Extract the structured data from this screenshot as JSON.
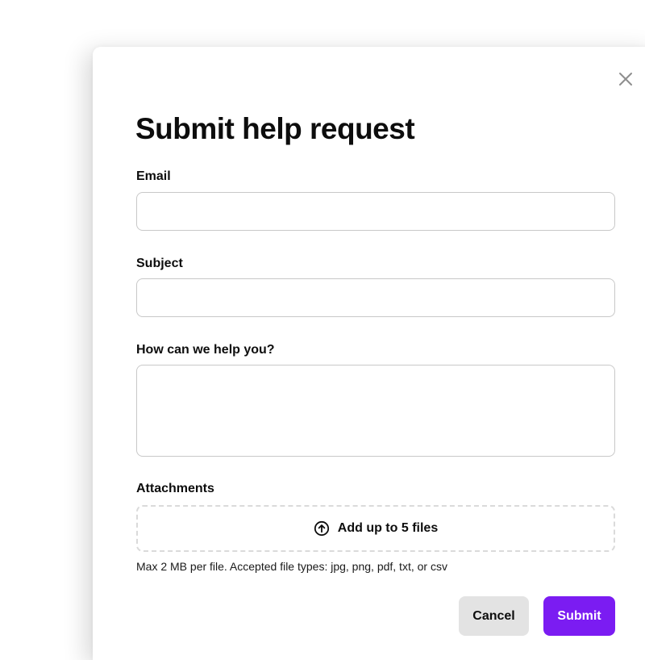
{
  "dialog": {
    "title": "Submit help request",
    "close_icon": "close-icon"
  },
  "form": {
    "email": {
      "label": "Email",
      "value": "",
      "placeholder": ""
    },
    "subject": {
      "label": "Subject",
      "value": "",
      "placeholder": ""
    },
    "message": {
      "label": "How can we help you?",
      "value": "",
      "placeholder": ""
    },
    "attachments": {
      "label": "Attachments",
      "dropzone_label": "Add up to 5 files",
      "dropzone_icon": "upload-icon",
      "helper_text": "Max 2 MB per file. Accepted file types: jpg, png, pdf, txt, or csv"
    }
  },
  "actions": {
    "cancel_label": "Cancel",
    "submit_label": "Submit"
  },
  "colors": {
    "accent": "#7b1cf2",
    "cancel_background": "#e3e3e3",
    "input_border": "#c8c8c8",
    "dropzone_border": "#dadada",
    "text": "#0d0d0d"
  }
}
